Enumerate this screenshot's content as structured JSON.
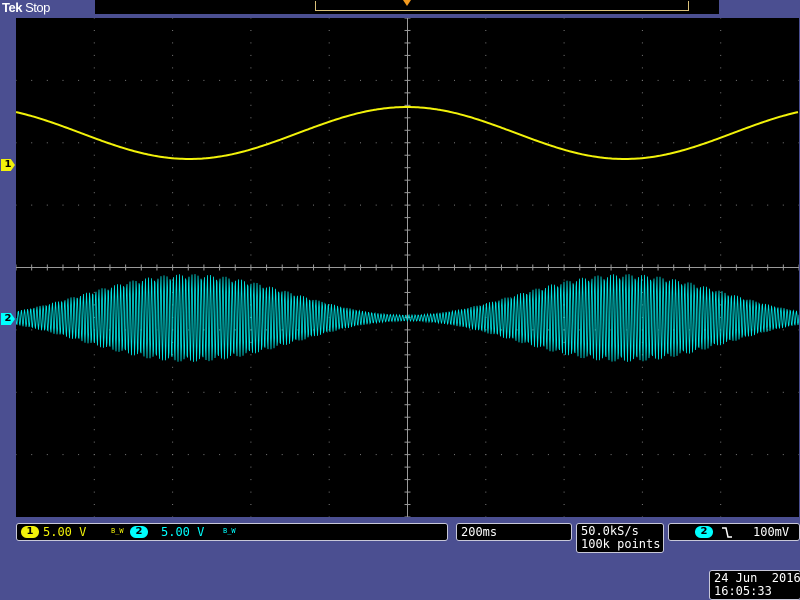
{
  "status": {
    "brand": "Tek",
    "state": "Stop"
  },
  "channels": [
    {
      "id": "1",
      "scale": "5.00 V",
      "bw_icon": "B_W",
      "color": "#f2f20a"
    },
    {
      "id": "2",
      "scale": "5.00 V",
      "bw_icon": "B_W",
      "color": "#00ffff"
    }
  ],
  "timebase": {
    "scale": "200ms"
  },
  "acquisition": {
    "sample_rate": "50.0kS/s",
    "record_length": "100k points"
  },
  "trigger": {
    "source": "2",
    "slope_icon": "falling-edge-icon",
    "level": "100mV"
  },
  "datetime": {
    "date": "24 Jun  2016",
    "time": "16:05:33"
  },
  "colors": {
    "background": "#4b4f91",
    "ch1": "#f2f20a",
    "ch2": "#00ffff",
    "trigger_marker": "#f39a1f",
    "graticule": "#8a8a8a"
  },
  "ch1_waveform": {
    "shape": "sine",
    "cycles_visible": 1.8
  },
  "ch2_waveform": {
    "shape": "amplitude-modulated",
    "envelope_cycles_visible": 1.8
  }
}
